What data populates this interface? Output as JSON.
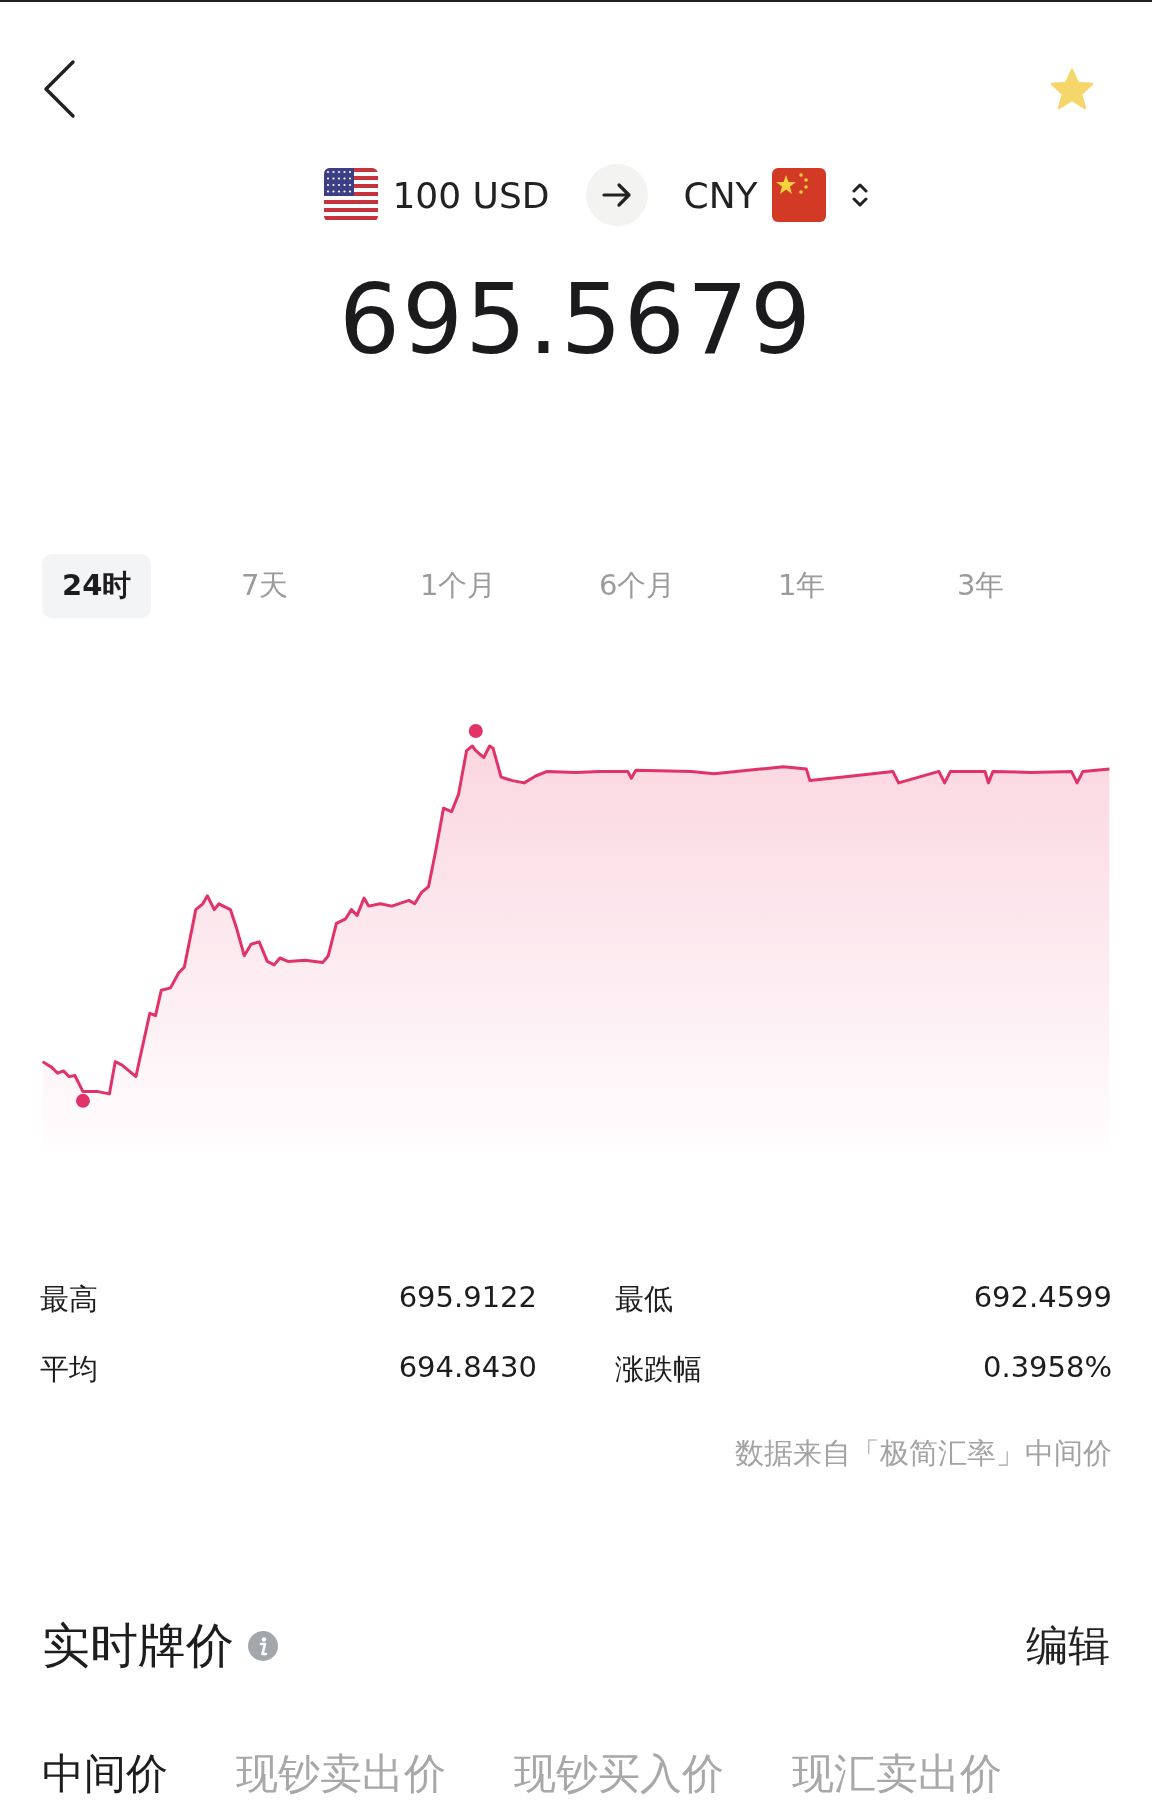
{
  "nav": {
    "favorited": true
  },
  "converter": {
    "from": {
      "kind": "us",
      "text": "100 USD"
    },
    "to": {
      "kind": "cn",
      "text": "CNY"
    }
  },
  "rate": "695.5679",
  "periods": [
    {
      "label": "24时",
      "selected": true
    },
    {
      "label": "7天",
      "selected": false
    },
    {
      "label": "1个月",
      "selected": false
    },
    {
      "label": "6个月",
      "selected": false
    },
    {
      "label": "1年",
      "selected": false
    },
    {
      "label": "3年",
      "selected": false
    }
  ],
  "stats": [
    {
      "label": "最高",
      "value": "695.9122"
    },
    {
      "label": "最低",
      "value": "692.4599"
    },
    {
      "label": "平均",
      "value": "694.8430"
    },
    {
      "label": "涨跌幅",
      "value": "0.3958%"
    }
  ],
  "source": "数据来自「极简汇率」中间价",
  "section": {
    "title": "实时牌价",
    "edit": "编辑"
  },
  "price_tabs": [
    {
      "label": "中间价",
      "selected": true
    },
    {
      "label": "现钞卖出价",
      "selected": false
    },
    {
      "label": "现钞买入价",
      "selected": false
    },
    {
      "label": "现汇卖出价",
      "selected": false
    }
  ]
}
